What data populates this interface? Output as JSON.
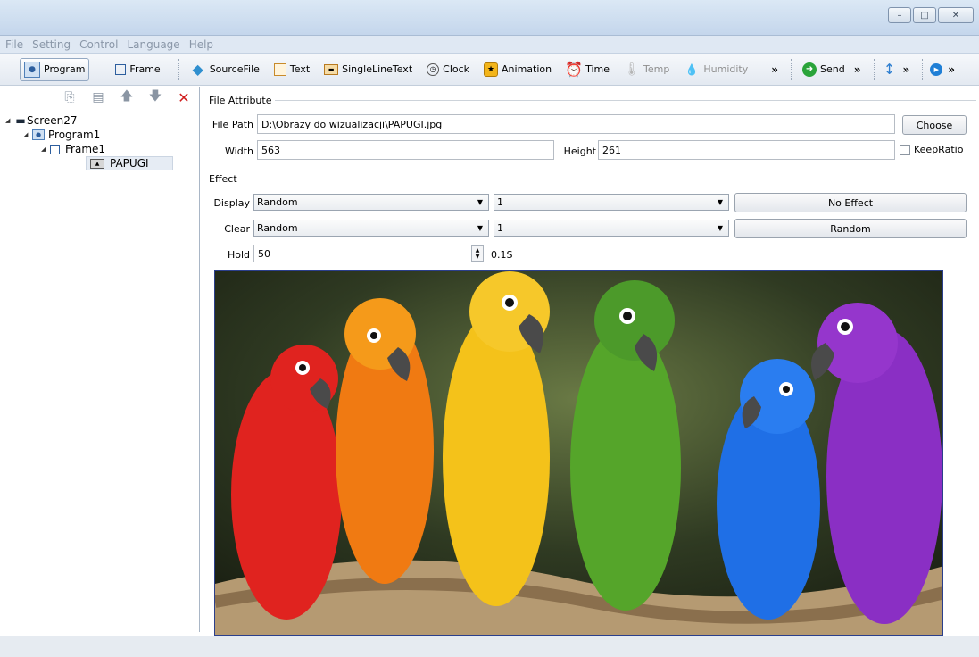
{
  "window": {
    "minimize": "–",
    "maximize": "□",
    "close": "✕"
  },
  "menu": [
    "File",
    "Setting",
    "Control",
    "Language",
    "Help"
  ],
  "toolbar": {
    "program": "Program",
    "frame": "Frame",
    "sourcefile": "SourceFile",
    "text": "Text",
    "singlelinetext": "SingleLineText",
    "clock": "Clock",
    "animation": "Animation",
    "time": "Time",
    "temp": "Temp",
    "humidity": "Humidity",
    "send": "Send",
    "more": "»"
  },
  "tree": {
    "screen": "Screen27",
    "program": "Program1",
    "frame": "Frame1",
    "item": "PAPUGI"
  },
  "file_attribute": {
    "title": "File Attribute",
    "file_path_label": "File Path",
    "file_path_value": "D:\\Obrazy do wizualizacji\\PAPUGI.jpg",
    "choose": "Choose",
    "width_label": "Width",
    "width_value": "563",
    "height_label": "Height",
    "height_value": "261",
    "keep_ratio": "KeepRatio"
  },
  "effect": {
    "title": "Effect",
    "display_label": "Display",
    "display_value": "Random",
    "display_speed": "1",
    "display_button": "No Effect",
    "clear_label": "Clear",
    "clear_value": "Random",
    "clear_speed": "1",
    "clear_button": "Random",
    "hold_label": "Hold",
    "hold_value": "50",
    "hold_unit": "0.1S"
  },
  "colors": {
    "accent": "#2b3f8c",
    "delete": "#d01e1e",
    "parrots": [
      "#e0231f",
      "#f07a12",
      "#f4c21a",
      "#55a52a",
      "#1f6fe6",
      "#8a2fc4"
    ]
  }
}
